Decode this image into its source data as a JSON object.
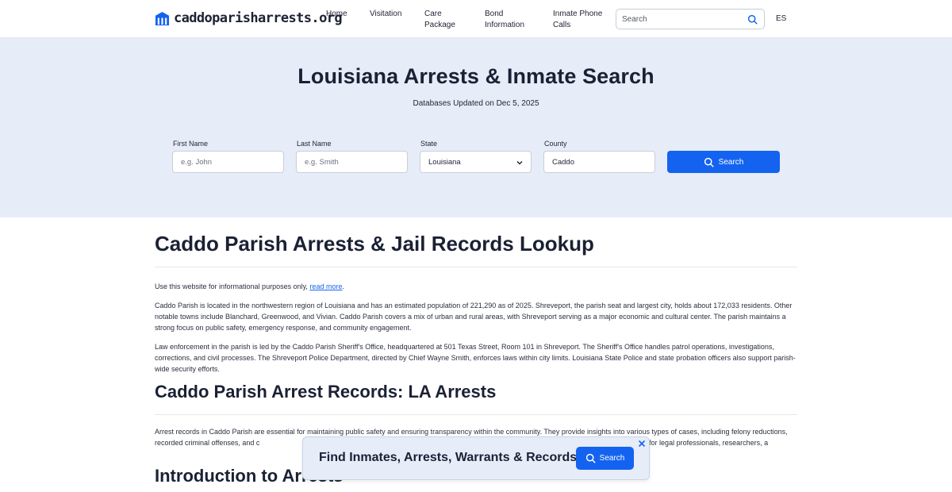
{
  "header": {
    "logo_text": "caddoparisharrests.org",
    "nav": {
      "home": "Home",
      "visitation": "Visitation",
      "care_package_1": "Care",
      "care_package_2": "Package",
      "bond_1": "Bond",
      "bond_2": "Information",
      "phone_1": "Inmate Phone",
      "phone_2": "Calls"
    },
    "search_placeholder": "Search",
    "lang": "ES"
  },
  "hero": {
    "title": "Louisiana Arrests & Inmate Search",
    "subtitle": "Databases Updated on Dec 5, 2025",
    "first_name_label": "First Name",
    "first_name_placeholder": "e.g. John",
    "last_name_label": "Last Name",
    "last_name_placeholder": "e.g. Smith",
    "state_label": "State",
    "state_value": "Louisiana",
    "county_label": "County",
    "county_value": "Caddo",
    "search_label": "Search"
  },
  "content": {
    "title": "Caddo Parish Arrests & Jail Records Lookup",
    "disclaimer_prefix": "Use this website for informational purposes only, ",
    "disclaimer_link": "read more",
    "disclaimer_suffix": ".",
    "para1": "Caddo Parish is located in the northwestern region of Louisiana and has an estimated population of 221,290 as of 2025. Shreveport, the parish seat and largest city, holds about 172,033 residents. Other notable towns include Blanchard, Greenwood, and Vivian. Caddo Parish covers a mix of urban and rural areas, with Shreveport serving as a major economic and cultural center. The parish maintains a strong focus on public safety, emergency response, and community engagement.",
    "para2": "Law enforcement in the parish is led by the Caddo Parish Sheriff's Office, headquartered at 501 Texas Street, Room 101 in Shreveport. The Sheriff's Office handles patrol operations, investigations, corrections, and civil processes. The Shreveport Police Department, directed by Chief Wayne Smith, enforces laws within city limits. Louisiana State Police and state probation officers also support parish-wide security efforts.",
    "section2_title": "Caddo Parish Arrest Records: LA Arrests",
    "para3": "Arrest records in Caddo Parish are essential for maintaining public safety and ensuring transparency within the community. They provide insights into various types of cases, including felony reductions, recorded criminal offenses, and c                                                                                                                   ccurate and up-to-date arrest information is crucial for legal professionals, researchers, a",
    "section3_title": "Introduction to Arrests"
  },
  "float_bar": {
    "title": "Find Inmates, Arrests, Warrants & Records",
    "search_label": "Search"
  },
  "colors": {
    "accent": "#1463f0",
    "hero_bg": "#e6ecf8",
    "text": "#1b2134"
  }
}
